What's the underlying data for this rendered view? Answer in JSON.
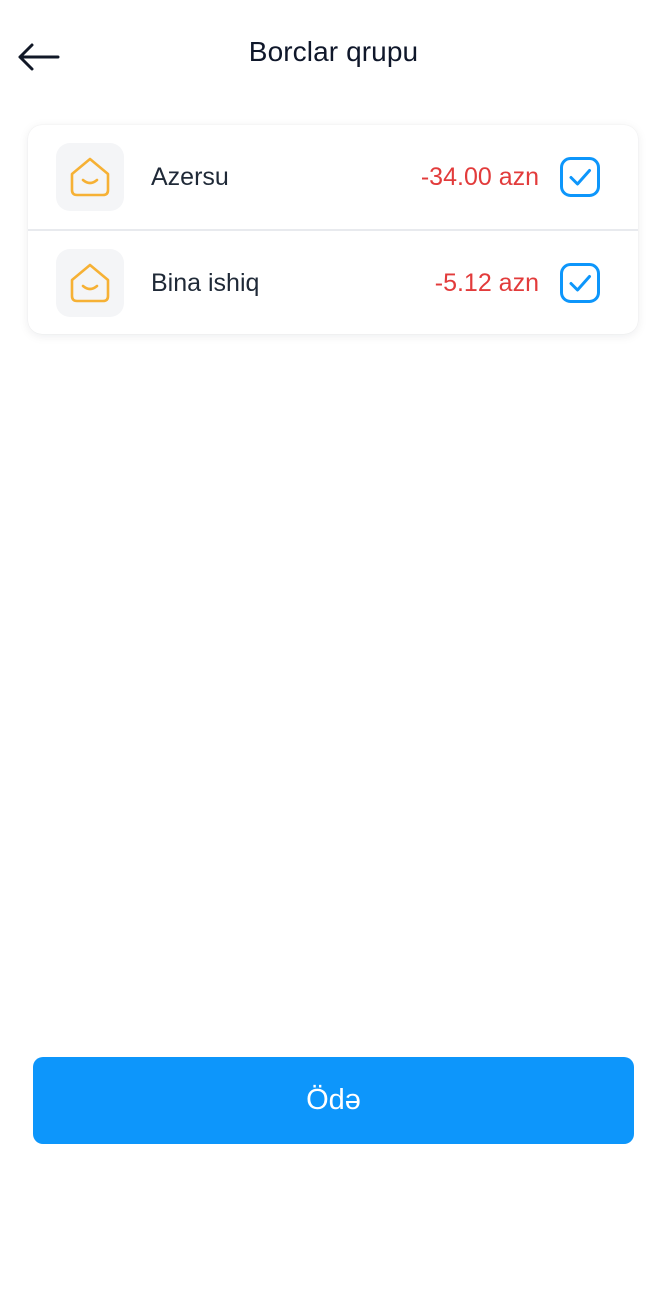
{
  "header": {
    "title": "Borclar qrupu"
  },
  "debts": [
    {
      "name": "Azersu",
      "amount": "-34.00 azn",
      "checked": true
    },
    {
      "name": "Bina ishiq",
      "amount": "-5.12 azn",
      "checked": true
    }
  ],
  "icons": {
    "back": "arrow-left-icon",
    "item": "house-smile-icon",
    "check": "checkbox-checked-icon"
  },
  "colors": {
    "accent": "#0d96fb",
    "amount": "#e23b3b",
    "icon": "#f6b135"
  },
  "footer": {
    "pay_label": "Ödə"
  }
}
